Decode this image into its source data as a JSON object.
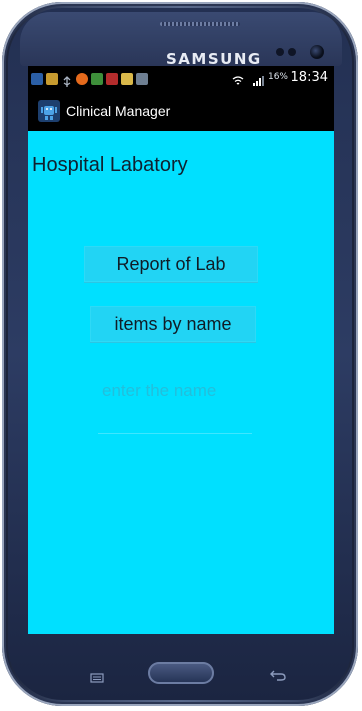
{
  "device": {
    "brand": "SAMSUNG"
  },
  "status_bar": {
    "battery": "16%",
    "time": "18:34"
  },
  "app": {
    "title": "Clinical Manager",
    "heading": "Hospital Labatory"
  },
  "actions": {
    "report_label": "Report of Lab",
    "items_label": "items by name"
  },
  "name_input": {
    "placeholder": "enter the name",
    "value": ""
  },
  "colors": {
    "screen_background": "#00e0ff",
    "button_background": "#22d4f4",
    "bar_background": "#000000"
  }
}
